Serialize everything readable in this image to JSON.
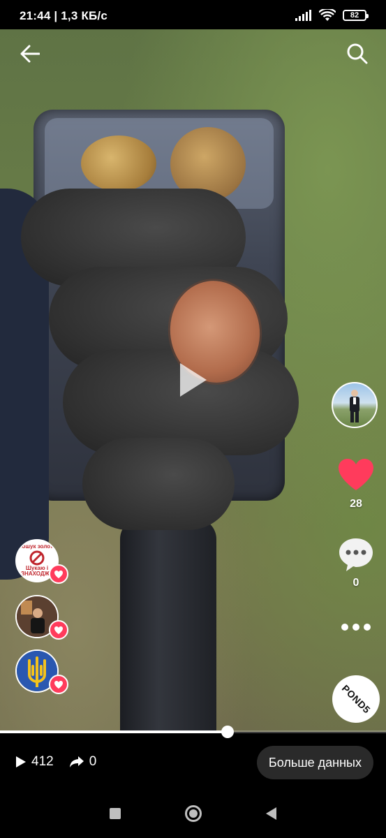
{
  "status_bar": {
    "time_speed": "21:44 | 1,3 КБ/с",
    "battery": "82"
  },
  "video": {
    "progress_fraction": 0.59
  },
  "sidebar": {
    "likes": "28",
    "comments": "0",
    "sound_disc_label": "POND5"
  },
  "reactions": [
    {
      "label_line1": "Пошук золота",
      "label_line2": "Шукаю і ЗНАХОДЖУ"
    },
    {
      "label": ""
    },
    {
      "label": ""
    }
  ],
  "bottom": {
    "views": "412",
    "shares": "0",
    "more_data_label": "Больше данных"
  },
  "icons": {
    "back": "arrow-left-icon",
    "search": "search-icon",
    "play": "play-icon",
    "like": "heart-icon",
    "comment": "comment-bubble-icon",
    "more": "more-dots-icon",
    "views": "play-small-icon",
    "shares": "share-arrow-icon"
  },
  "colors": {
    "like_red": "#ff3b5c",
    "progress_white": "#ffffff",
    "pill_bg": "#2a2a2a"
  }
}
